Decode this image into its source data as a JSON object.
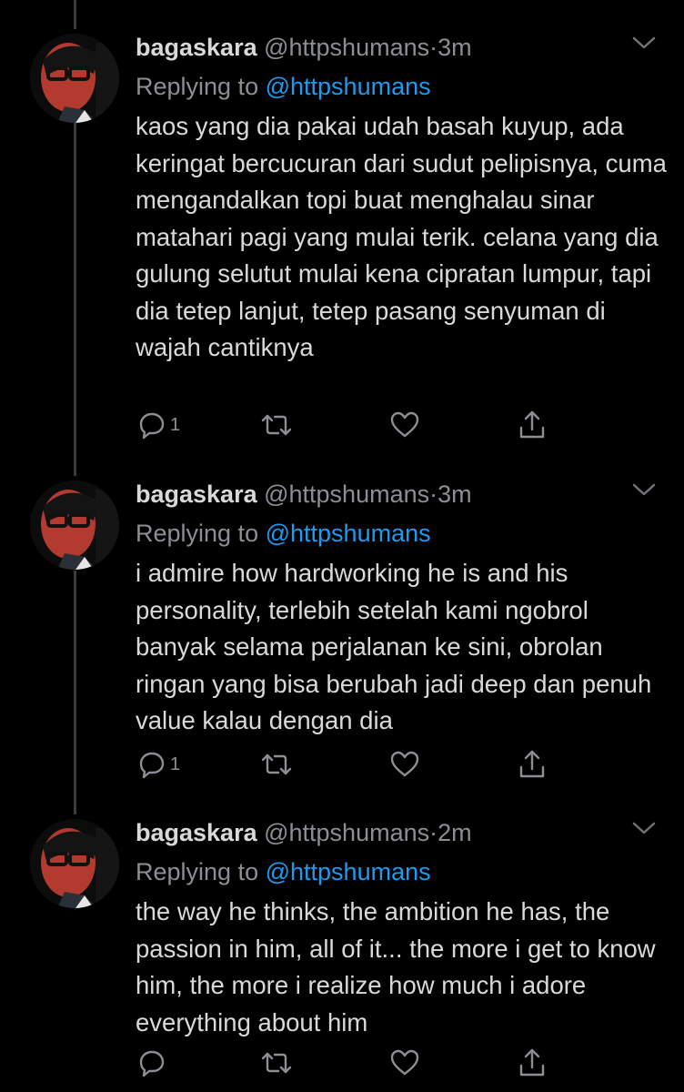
{
  "colors": {
    "background": "#000000",
    "text": "#d9d9d9",
    "muted": "#8b8f93",
    "link": "#1d9bf0",
    "thread_line": "#3a3d40"
  },
  "tweets": [
    {
      "name": "bagaskara",
      "handle": "@httpshumans",
      "dot": "·",
      "time": "3m",
      "replying_prefix": "Replying to",
      "replying_to": "@httpshumans",
      "text": "kaos yang dia pakai udah basah kuyup, ada keringat bercucuran dari sudut pelipisnya, cuma mengandalkan topi buat menghalau sinar matahari pagi yang mulai terik. celana yang dia gulung selutut mulai kena cipratan lumpur, tapi dia tetep lanjut, tetep pasang senyuman di wajah cantiknya",
      "reply_count": "1",
      "icons": [
        "reply-icon",
        "retweet-icon",
        "like-icon",
        "share-icon",
        "chevron-down-icon"
      ]
    },
    {
      "name": "bagaskara",
      "handle": "@httpshumans",
      "dot": "·",
      "time": "3m",
      "replying_prefix": "Replying to",
      "replying_to": "@httpshumans",
      "text": "i admire how hardworking he is and his personality, terlebih setelah kami ngobrol banyak selama perjalanan ke sini, obrolan ringan yang bisa berubah jadi deep dan penuh value kalau dengan dia",
      "reply_count": "1",
      "icons": [
        "reply-icon",
        "retweet-icon",
        "like-icon",
        "share-icon",
        "chevron-down-icon"
      ]
    },
    {
      "name": "bagaskara",
      "handle": "@httpshumans",
      "dot": "·",
      "time": "2m",
      "replying_prefix": "Replying to",
      "replying_to": "@httpshumans",
      "text": "the way he thinks, the ambition he has, the passion in him, all of it... the more i get to know him, the more i realize how much i adore everything about him",
      "reply_count": "",
      "icons": [
        "reply-icon",
        "retweet-icon",
        "like-icon",
        "share-icon",
        "chevron-down-icon"
      ]
    }
  ]
}
